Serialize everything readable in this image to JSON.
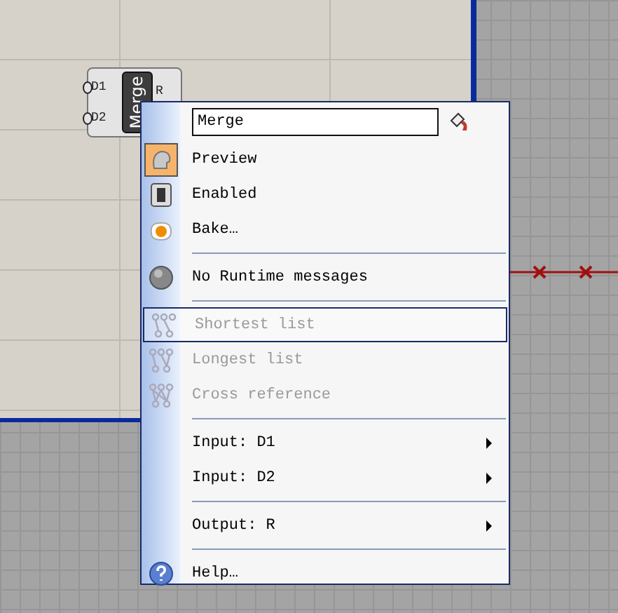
{
  "node": {
    "inputs": [
      "D1",
      "D2"
    ],
    "title": "Merge",
    "output": "R"
  },
  "menu": {
    "name_field": {
      "value": "Merge"
    },
    "items": [
      {
        "kind": "preview",
        "label": "Preview",
        "checked": true,
        "disabled": false,
        "selected": false
      },
      {
        "kind": "enable",
        "label": "Enabled",
        "checked": false,
        "disabled": false,
        "selected": false
      },
      {
        "kind": "bake",
        "label": "Bake…",
        "disabled": false,
        "selected": false
      },
      {
        "kind": "separator"
      },
      {
        "kind": "status",
        "label": "No Runtime messages",
        "disabled": false,
        "selected": false
      },
      {
        "kind": "separator"
      },
      {
        "kind": "shortest",
        "label": "Shortest list",
        "disabled": true,
        "selected": true
      },
      {
        "kind": "longest",
        "label": "Longest list",
        "disabled": true,
        "selected": false
      },
      {
        "kind": "cross",
        "label": "Cross reference",
        "disabled": true,
        "selected": false
      },
      {
        "kind": "separator"
      },
      {
        "kind": "submenu",
        "label": "Input: D1",
        "disabled": false,
        "selected": false
      },
      {
        "kind": "submenu",
        "label": "Input: D2",
        "disabled": false,
        "selected": false
      },
      {
        "kind": "separator"
      },
      {
        "kind": "submenu",
        "label": "Output: R",
        "disabled": false,
        "selected": false
      },
      {
        "kind": "separator"
      },
      {
        "kind": "help",
        "label": "Help…",
        "disabled": false,
        "selected": false
      }
    ]
  }
}
